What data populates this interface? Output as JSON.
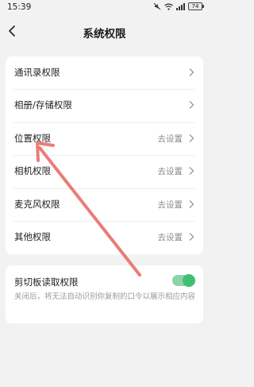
{
  "status_bar": {
    "time": "15:39",
    "battery": "74",
    "icons": [
      "mute-icon",
      "wifi-icon",
      "signal-icon",
      "battery-icon"
    ]
  },
  "nav": {
    "title": "系统权限",
    "back_icon": "chevron-left-icon"
  },
  "permissions": [
    {
      "label": "通讯录权限",
      "value": ""
    },
    {
      "label": "相册/存储权限",
      "value": ""
    },
    {
      "label": "位置权限",
      "value": "去设置"
    },
    {
      "label": "相机权限",
      "value": "去设置"
    },
    {
      "label": "麦克风权限",
      "value": "去设置"
    },
    {
      "label": "其他权限",
      "value": "去设置"
    }
  ],
  "clipboard": {
    "title": "剪切板读取权限",
    "description": "关闭后，将无法自动识别你复制的口令以展示相应内容",
    "enabled": true
  },
  "colors": {
    "accent": "#3fbf72",
    "annotation_arrow": "#e8736b"
  }
}
